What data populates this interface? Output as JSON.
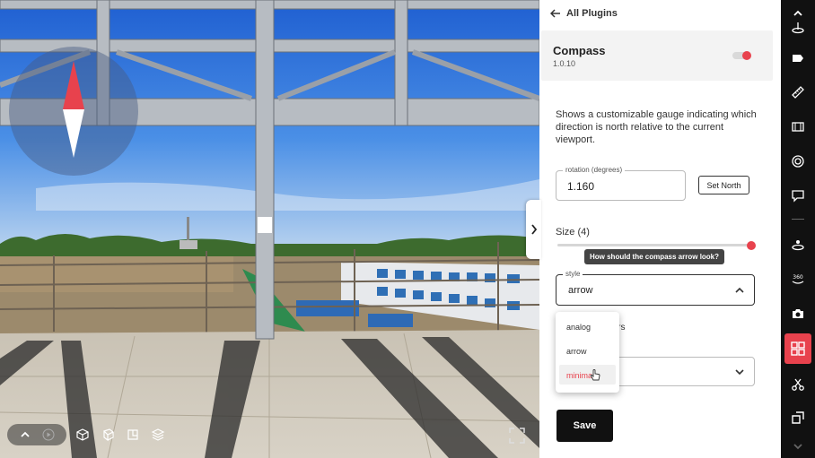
{
  "panel": {
    "back_label": "All Plugins",
    "plugin_name": "Compass",
    "plugin_version": "1.0.10",
    "plugin_enabled": true,
    "description": "Shows a customizable gauge indicating which direction is north relative to the current viewport.",
    "rotation_label": "rotation (degrees)",
    "rotation_value": "1.160",
    "set_north_label": "Set North",
    "size_label": "Size (4)",
    "size_fraction": 1.0,
    "tooltip": "How should the compass arrow look?",
    "style_label": "style",
    "style_value": "arrow",
    "style_options": [
      "analog",
      "arrow",
      "minimal"
    ],
    "partial_label": "ours",
    "save_label": "Save"
  },
  "colors": {
    "accent": "#e8424d",
    "rail_bg": "#111111",
    "save_bg": "#111111"
  },
  "rail_icons": [
    "chevron-up-icon",
    "cursor-icon",
    "tag-icon",
    "ruler-icon",
    "film-icon",
    "target-icon",
    "comment-icon",
    "hotspot-icon",
    "rotate-360-icon",
    "camera-icon",
    "plugins-icon",
    "scissors-icon",
    "box-icon",
    "chevron-down-icon"
  ]
}
